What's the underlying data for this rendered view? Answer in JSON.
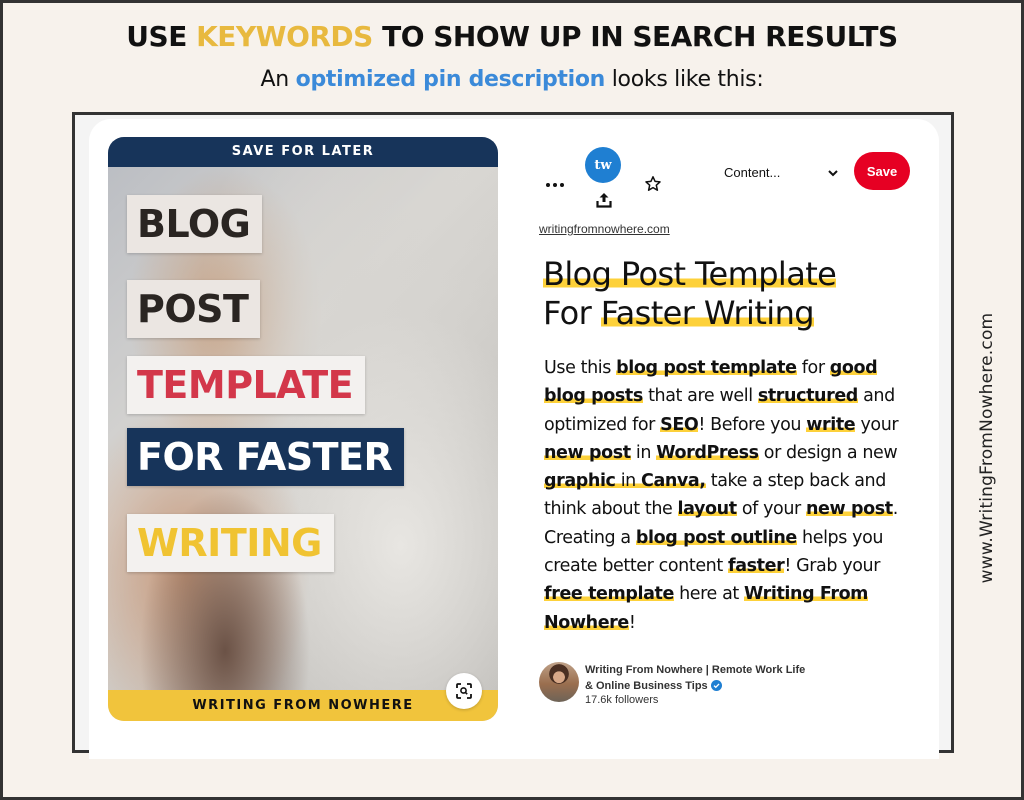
{
  "header": {
    "headline_pre": "USE ",
    "headline_keyword": "KEYWORDS",
    "headline_post": " TO SHOW UP IN SEARCH RESULTS",
    "subhead_pre": "An ",
    "subhead_accent": "optimized pin description",
    "subhead_post": " looks like this:"
  },
  "colors": {
    "keyword_gold": "#e8b93f",
    "accent_blue": "#3b8ad9",
    "save_red": "#e60023",
    "highlight_yellow": "#fdd13a",
    "navy": "#17345a"
  },
  "pin_image": {
    "top_banner": "SAVE FOR LATER",
    "words": [
      "BLOG",
      "POST",
      "TEMPLATE",
      "FOR FASTER",
      "WRITING"
    ],
    "bottom_banner": "WRITING FROM NOWHERE",
    "lens_icon": "visual-search-icon"
  },
  "toolbar": {
    "more_icon": "more-dots-icon",
    "profile_initials": "tw",
    "share_icon": "share-upload-icon",
    "star_icon": "star-outline-icon",
    "board_select_value": "Content...",
    "chevron_icon": "chevron-down-icon",
    "save_label": "Save"
  },
  "pin": {
    "source_link": "writingfromnowhere.com",
    "title_line1": "Blog Post Template",
    "title_for": "For ",
    "title_line2_hl": "Faster Writing",
    "description": [
      {
        "t": "Use this ",
        "hl": false
      },
      {
        "t": "blog post template",
        "hl": true,
        "b": true
      },
      {
        "t": " for ",
        "hl": false
      },
      {
        "t": "good blog posts",
        "hl": true,
        "b": true
      },
      {
        "t": " that are well ",
        "hl": false
      },
      {
        "t": "structured",
        "hl": true,
        "b": true
      },
      {
        "t": " and optimized for ",
        "hl": false
      },
      {
        "t": "SEO",
        "hl": true,
        "b": true
      },
      {
        "t": "! Before you ",
        "hl": false
      },
      {
        "t": "write",
        "hl": true,
        "b": true
      },
      {
        "t": " your ",
        "hl": false
      },
      {
        "t": "new post",
        "hl": true,
        "b": true
      },
      {
        "t": " in ",
        "hl": false
      },
      {
        "t": "WordPress",
        "hl": true,
        "b": true
      },
      {
        "t": " or design a new ",
        "hl": false
      },
      {
        "t": "graphic",
        "hl": true,
        "b": true
      },
      {
        "t": " in ",
        "hl": true,
        "b": false
      },
      {
        "t": "Canva,",
        "hl": true,
        "b": true
      },
      {
        "t": " take a step back and think about the ",
        "hl": false
      },
      {
        "t": "layout",
        "hl": true,
        "b": true
      },
      {
        "t": " of your ",
        "hl": false
      },
      {
        "t": "new post",
        "hl": true,
        "b": true
      },
      {
        "t": ". Creating a ",
        "hl": false
      },
      {
        "t": "blog post outline",
        "hl": true,
        "b": true
      },
      {
        "t": " helps you create better content ",
        "hl": false
      },
      {
        "t": "faster",
        "hl": true,
        "b": true
      },
      {
        "t": "! Grab your ",
        "hl": false
      },
      {
        "t": "free template",
        "hl": true,
        "b": true
      },
      {
        "t": " here at ",
        "hl": false
      },
      {
        "t": "Writing From Nowhere",
        "hl": true,
        "b": true
      },
      {
        "t": "!",
        "hl": false
      }
    ]
  },
  "creator": {
    "name": "Writing From Nowhere | Remote Work Life & Online Business Tips",
    "verified_icon": "verified-check-icon",
    "followers": "17.6k followers"
  },
  "side_url": "www.WritingFromNowhere.com"
}
